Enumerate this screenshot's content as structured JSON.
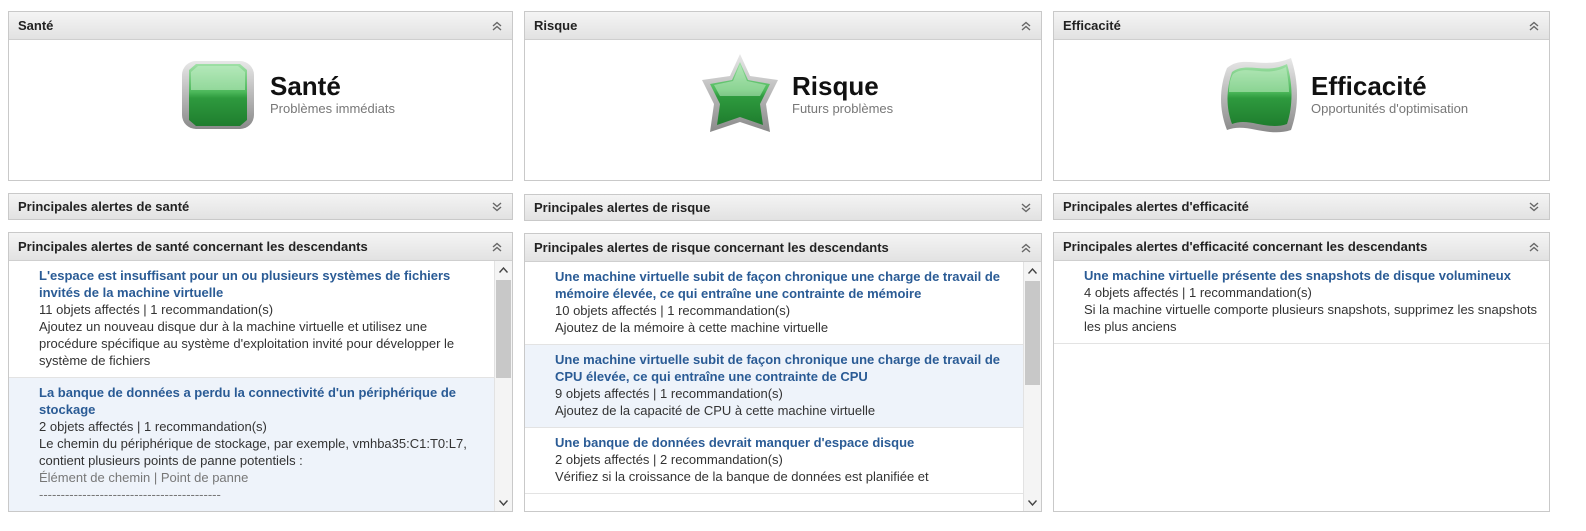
{
  "health": {
    "header": "Santé",
    "badge_title": "Santé",
    "badge_subtitle": "Problèmes immédiats",
    "alerts_header": "Principales alertes de santé",
    "descendants_header": "Principales alertes de santé concernant les descendants",
    "items": [
      {
        "title": "L'espace est insuffisant pour un ou plusieurs systèmes de fichiers invités de la machine virtuelle",
        "meta": "11 objets affectés | 1 recommandation(s)",
        "desc": "Ajoutez un nouveau disque dur à la machine virtuelle et utilisez une procédure spécifique au système d'exploitation invité pour développer le système de fichiers"
      },
      {
        "title": "La banque de données a perdu la connectivité d'un périphérique de stockage",
        "meta": "2 objets affectés | 1 recommandation(s)",
        "desc": "Le chemin du périphérique de stockage, par exemple, vmhba35:C1:T0:L7, contient plusieurs points de panne potentiels :",
        "desc_muted": "Élément de chemin | Point de panne",
        "desc_extra": "------------------------------------------"
      }
    ]
  },
  "risk": {
    "header": "Risque",
    "badge_title": "Risque",
    "badge_subtitle": "Futurs problèmes",
    "alerts_header": "Principales alertes de risque",
    "descendants_header": "Principales alertes de risque concernant les descendants",
    "items": [
      {
        "title": "Une machine virtuelle subit de façon chronique une charge de travail de mémoire élevée, ce qui entraîne une contrainte de mémoire",
        "meta": "10 objets affectés | 1 recommandation(s)",
        "desc": "Ajoutez de la mémoire à cette machine virtuelle"
      },
      {
        "title": "Une machine virtuelle subit de façon chronique une charge de travail de CPU élevée, ce qui entraîne une contrainte de CPU",
        "meta": "9 objets affectés | 1 recommandation(s)",
        "desc": "Ajoutez de la capacité de CPU à cette machine virtuelle"
      },
      {
        "title": "Une banque de données devrait manquer d'espace disque",
        "meta": "2 objets affectés | 2 recommandation(s)",
        "desc": "Vérifiez si la croissance de la banque de données est planifiée et"
      }
    ]
  },
  "efficiency": {
    "header": "Efficacité",
    "badge_title": "Efficacité",
    "badge_subtitle": "Opportunités d'optimisation",
    "alerts_header": "Principales alertes d'efficacité",
    "descendants_header": "Principales alertes d'efficacité concernant les descendants",
    "items": [
      {
        "title": "Une machine virtuelle présente des snapshots de disque volumineux",
        "meta": "4 objets affectés | 1 recommandation(s)",
        "desc": "Si la machine virtuelle comporte plusieurs snapshots, supprimez les snapshots les plus anciens"
      }
    ]
  },
  "icons": {
    "collapse": "double-chevron-up-icon",
    "expand": "double-chevron-down-icon",
    "health_badge": "health-badge-icon",
    "risk_badge": "risk-badge-icon",
    "efficiency_badge": "efficiency-badge-icon"
  },
  "colors": {
    "badge_green": "#3da84a",
    "link_blue": "#2a5b95",
    "selected_row": "#eef3fa"
  }
}
